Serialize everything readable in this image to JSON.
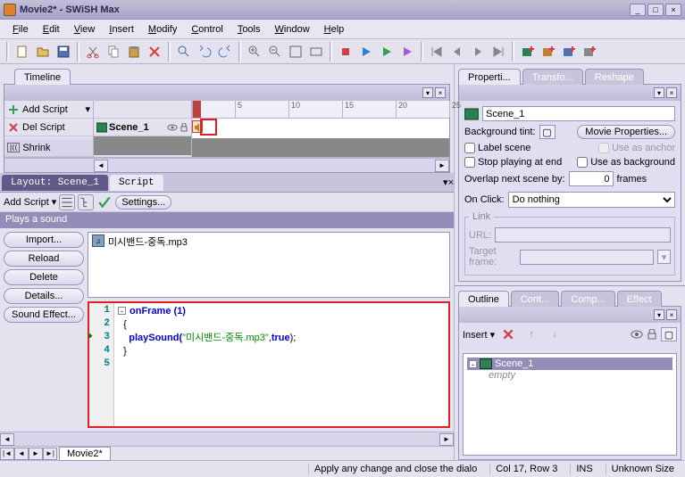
{
  "title": "Movie2* - SWiSH Max",
  "menu": [
    "File",
    "Edit",
    "View",
    "Insert",
    "Modify",
    "Control",
    "Tools",
    "Window",
    "Help"
  ],
  "tabs": {
    "timeline": "Timeline"
  },
  "timeline": {
    "add_script": "Add Script",
    "del_script": "Del Script",
    "shrink": "Shrink",
    "scene_label": "Scene_1",
    "ticks": [
      "1",
      "5",
      "10",
      "15",
      "20",
      "25"
    ]
  },
  "layout": {
    "tab_layout": "Layout: Scene_1",
    "tab_script": "Script",
    "add_script": "Add Script",
    "settings": "Settings...",
    "desc": "Plays a sound",
    "side_buttons": [
      "Import...",
      "Reload",
      "Delete",
      "Details...",
      "Sound Effect..."
    ],
    "audio_file": "미시밴드-중독.mp3",
    "code": {
      "l1_kw": "onFrame",
      "l1_num": "(1)",
      "l2": "{",
      "l3_fn": "playSound(",
      "l3_str": "\"미시밴드-중독.mp3\"",
      "l3_mid": ",",
      "l3_true": "true",
      "l3_end": ");",
      "l4": "}"
    },
    "movie_tab": "Movie2*"
  },
  "props": {
    "tabs": [
      "Properti...",
      "Transfo...",
      "Reshape"
    ],
    "scene_name": "Scene_1",
    "bg_tint": "Background tint:",
    "movie_props": "Movie Properties...",
    "label_scene": "Label scene",
    "use_anchor": "Use as anchor",
    "stop_end": "Stop playing at end",
    "use_bg": "Use as background",
    "overlap": "Overlap next scene by:",
    "overlap_val": "0",
    "frames": "frames",
    "on_click": "On Click:",
    "on_click_val": "Do nothing",
    "link": "Link",
    "url": "URL:",
    "target": "Target frame:"
  },
  "outline": {
    "tabs": [
      "Outline",
      "Cont...",
      "Comp...",
      "Effect"
    ],
    "insert": "Insert",
    "scene": "Scene_1",
    "empty": "empty"
  },
  "status": {
    "msg": "Apply any change and close the dialo",
    "col": "Col 17, Row 3",
    "ins": "INS",
    "size": "Unknown Size"
  }
}
